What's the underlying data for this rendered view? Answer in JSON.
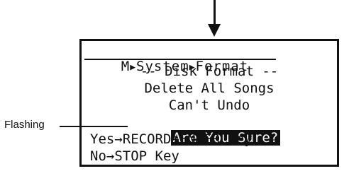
{
  "breadcrumb": {
    "root": "M",
    "separator": "▶",
    "level1": "System",
    "level2": "Format"
  },
  "screen": {
    "line1": "-- Disk Format --",
    "line2": "Delete All Songs",
    "line3": "Can't Undo",
    "prompt": "Are You Sure?",
    "yes_option": "Yes→RECORD+ENTER Key",
    "no_option": "No→STOP Key"
  },
  "callout": {
    "label": "Flashing"
  }
}
